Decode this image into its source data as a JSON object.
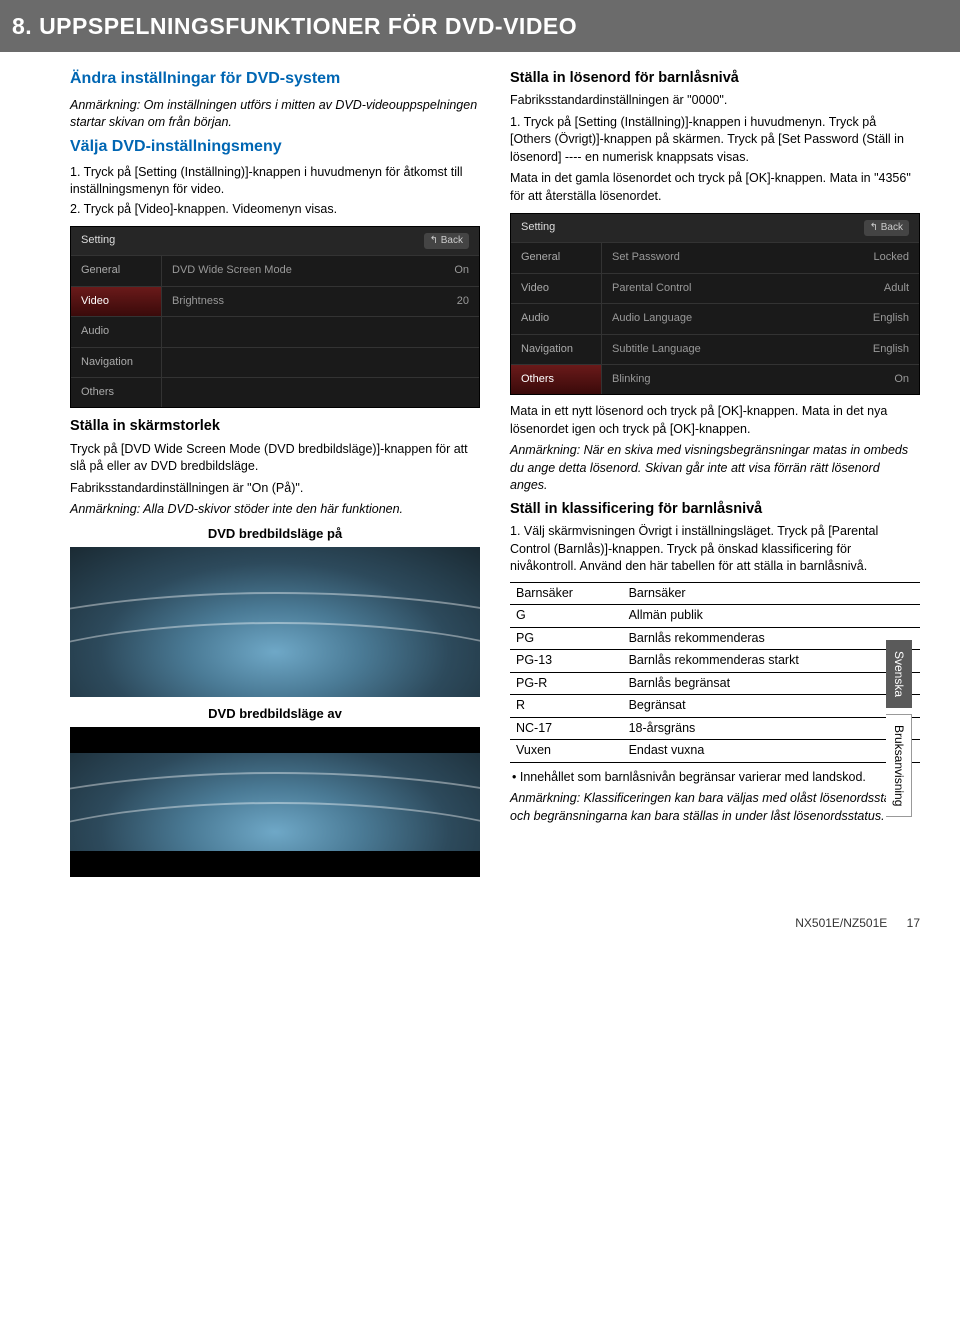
{
  "titlebar": "8. UPPSPELNINGSFUNKTIONER FÖR DVD-VIDEO",
  "left": {
    "h1": "Ändra inställningar för DVD-system",
    "note1": "Anmärkning: Om inställningen utförs i mitten av DVD-videouppspelningen startar skivan om från början.",
    "h2": "Välja DVD-inställningsmeny",
    "step1": "1. Tryck på [Setting (Inställning)]-knappen i huvudmenyn för åtkomst till inställningsmenyn för video.",
    "step2": "2. Tryck på [Video]-knappen. Videomenyn visas.",
    "menu1": {
      "title": "Setting",
      "back": "↰ Back",
      "rows": [
        {
          "side": "General",
          "sel": false,
          "c1": "DVD Wide Screen Mode",
          "c2": "On"
        },
        {
          "side": "Video",
          "sel": true,
          "c1": "Brightness",
          "c2": "20"
        },
        {
          "side": "Audio",
          "sel": false,
          "c1": "",
          "c2": ""
        },
        {
          "side": "Navigation",
          "sel": false,
          "c1": "",
          "c2": ""
        },
        {
          "side": "Others",
          "sel": false,
          "c1": "",
          "c2": ""
        }
      ]
    },
    "h3": "Ställa in skärmstorlek",
    "p3a": "Tryck på [DVD Wide Screen Mode (DVD bredbildsläge)]-knappen för att slå på eller av DVD bredbildsläge.",
    "p3b": "Fabriksstandardinställningen är \"On (På)\".",
    "note3": "Anmärkning: Alla DVD-skivor stöder inte den här funktionen.",
    "cap_on": "DVD bredbildsläge på",
    "cap_off": "DVD bredbildsläge av"
  },
  "right": {
    "h1": "Ställa in lösenord för barnlåsnivå",
    "p1": "Fabriksstandardinställningen är \"0000\".",
    "step1": "1. Tryck på [Setting (Inställning)]-knappen i huvudmenyn. Tryck på [Others (Övrigt)]-knappen på skärmen. Tryck på [Set Password (Ställ in lösenord] ---- en numerisk knappsats visas.",
    "p2": "Mata in det gamla lösenordet och tryck på [OK]-knappen. Mata in \"4356\" för att återställa lösenordet.",
    "menu2": {
      "title": "Setting",
      "back": "↰ Back",
      "rows": [
        {
          "side": "General",
          "sel": false,
          "c1": "Set Password",
          "c2": "Locked"
        },
        {
          "side": "Video",
          "sel": false,
          "c1": "Parental Control",
          "c2": "Adult"
        },
        {
          "side": "Audio",
          "sel": false,
          "c1": "Audio Language",
          "c2": "English"
        },
        {
          "side": "Navigation",
          "sel": false,
          "c1": "Subtitle Language",
          "c2": "English"
        },
        {
          "side": "Others",
          "sel": true,
          "c1": "Blinking",
          "c2": "On"
        }
      ]
    },
    "p3": "Mata in ett nytt lösenord och tryck på [OK]-knappen. Mata in det nya lösenordet igen och tryck på [OK]-knappen.",
    "note2": "Anmärkning: När en skiva med visningsbegränsningar matas in ombeds du ange detta lösenord. Skivan går inte att visa förrän rätt lösenord anges.",
    "h2": "Ställ in klassificering för barnlåsnivå",
    "step2": "1. Välj skärmvisningen Övrigt i inställningsläget. Tryck på [Parental Control (Barnlås)]-knappen. Tryck på önskad klassificering för nivåkontroll. Använd den här tabellen för att ställa in barnlåsnivå.",
    "ratings": [
      [
        "Barnsäker",
        "Barnsäker"
      ],
      [
        "G",
        "Allmän publik"
      ],
      [
        "PG",
        "Barnlås rekommenderas"
      ],
      [
        "PG-13",
        "Barnlås rekommenderas starkt"
      ],
      [
        "PG-R",
        "Barnlås begränsat"
      ],
      [
        "R",
        "Begränsat"
      ],
      [
        "NC-17",
        "18-årsgräns"
      ],
      [
        "Vuxen",
        "Endast vuxna"
      ]
    ],
    "bullet": "• Innehållet som barnlåsnivån begränsar varierar med landskod.",
    "note3": "Anmärkning: Klassificeringen kan bara väljas med olåst lösenordsstatus och begränsningarna kan bara ställas in under låst lösenordsstatus."
  },
  "tabs": {
    "a": "Svenska",
    "b": "Bruksanvisning"
  },
  "footer": {
    "model": "NX501E/NZ501E",
    "page": "17"
  }
}
